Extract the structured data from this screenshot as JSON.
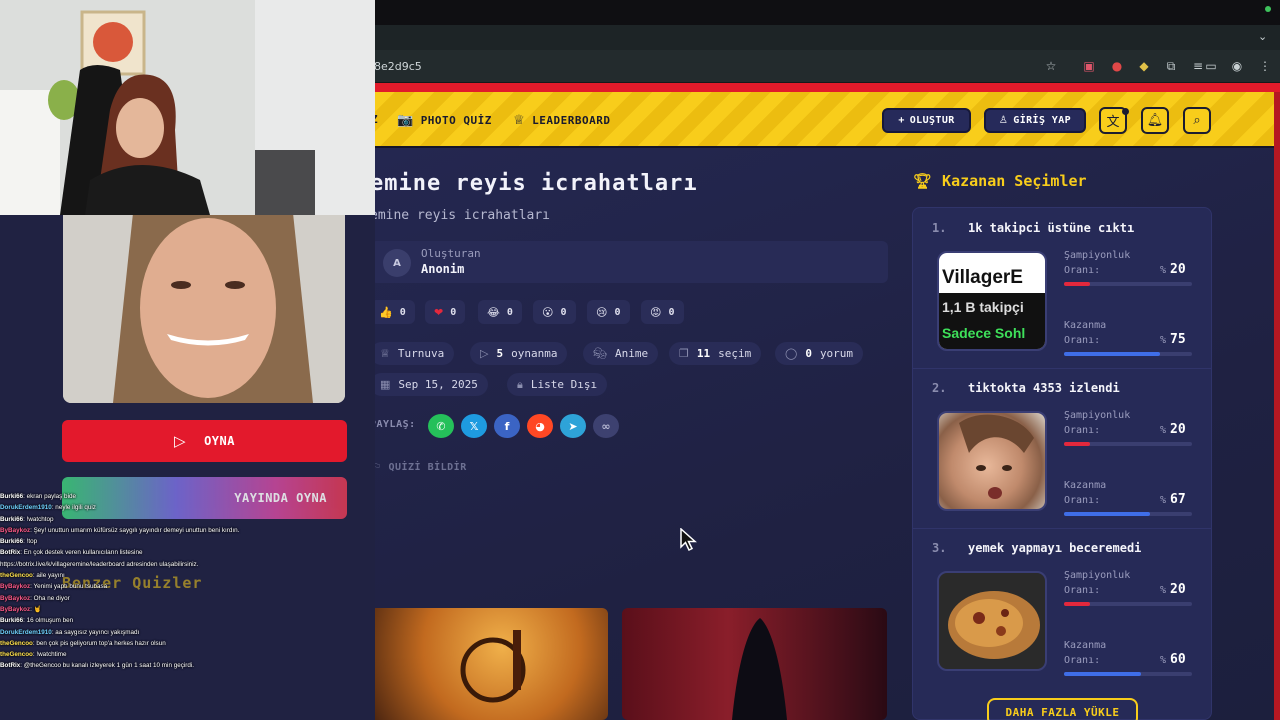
{
  "browser": {
    "url": "8e2d9c5"
  },
  "nav": {
    "photo_quiz": "PHOTO QUİZ",
    "leaderboard": "LEADERBOARD",
    "create": "OLUŞTUR",
    "login": "GİRİŞ YAP"
  },
  "quiz": {
    "title": "emine reyis icrahatları",
    "subtitle": "emine reyis icrahatları",
    "creator_label": "Oluşturan",
    "creator_name": "Anonim",
    "creator_initial": "A",
    "reactions": [
      {
        "emoji": "👍",
        "count": "0"
      },
      {
        "emoji": "❤",
        "count": "0"
      },
      {
        "emoji": "😂",
        "count": "0"
      },
      {
        "emoji": "😮",
        "count": "0"
      },
      {
        "emoji": "😢",
        "count": "0"
      },
      {
        "emoji": "😡",
        "count": "0"
      }
    ],
    "tags": {
      "type": "Turnuva",
      "plays_num": "5",
      "plays_label": "oynanma",
      "category": "Anime",
      "choices_num": "11",
      "choices_label": "seçim",
      "comments_num": "0",
      "comments_label": "yorum",
      "date": "Sep 15, 2025",
      "visibility": "Liste Dışı"
    },
    "share_label": "PAYLAŞ:",
    "report_label": "QUİZİ BİLDİR"
  },
  "left": {
    "play_label": "OYNA",
    "live_label": "YAYINDA OYNA",
    "similar_title": "Benzer Quizler"
  },
  "winners": {
    "title": "Kazanan Seçimler",
    "champ_label_1": "Şampiyonluk",
    "champ_label_2": "Oranı:",
    "win_label_1": "Kazanma",
    "win_label_2": "Oranı:",
    "pct": "%",
    "items": [
      {
        "rank": "1.",
        "name": "1k takipci üstüne cıktı",
        "champ": "20",
        "win": "75",
        "img_text_1": "VillagerE",
        "img_text_2": "1,1 B takipçi",
        "img_text_3": "Sadece Sohl"
      },
      {
        "rank": "2.",
        "name": "tiktokta 4353 izlendi",
        "champ": "20",
        "win": "67"
      },
      {
        "rank": "3.",
        "name": "yemek yapmayı beceremedi",
        "champ": "20",
        "win": "60"
      }
    ],
    "more_label": "DAHA FAZLA YÜKLE"
  },
  "chat": [
    {
      "user": "Burki66",
      "color": "#ffffff",
      "msg": ": ekran paylaş bide"
    },
    {
      "user": "DorukErdem1910",
      "color": "#6fd3ff",
      "msg": ": neyle ilgili quiz"
    },
    {
      "user": "Burki66",
      "color": "#ffffff",
      "msg": ": !watchtop"
    },
    {
      "user": "ByBaykoz",
      "color": "#ff5a8a",
      "msg": ": Şey! unuttun umarım küfürsüz saygılı yayındır demeyi unuttun beni kırdın."
    },
    {
      "user": "Burki66",
      "color": "#ffffff",
      "msg": ": !top"
    },
    {
      "user": "BotRix",
      "color": "#ffffff",
      "msg": ": En çok destek veren kullanıcıların listesine"
    },
    {
      "user": "",
      "color": "#ffffff",
      "msg": "https://botrix.live/k/villageremine/leaderboard adresinden ulaşabilirsiniz."
    },
    {
      "user": "theGencoo",
      "color": "#ffe14d",
      "msg": ": aile yayını"
    },
    {
      "user": "ByBaykoz",
      "color": "#ff5a8a",
      "msg": ": Yenimi yaptı bunu tsubasa"
    },
    {
      "user": "ByBaykoz",
      "color": "#ff5a8a",
      "msg": ": Oha ne diyor"
    },
    {
      "user": "ByBaykoz",
      "color": "#ff5a8a",
      "msg": ": 🤘"
    },
    {
      "user": "Burki66",
      "color": "#ffffff",
      "msg": ": 16 olmuşum ben"
    },
    {
      "user": "DorukErdem1910",
      "color": "#6fd3ff",
      "msg": ": aa saygısız yayıncı yakışmadı"
    },
    {
      "user": "theGencoo",
      "color": "#ffe14d",
      "msg": ": ben çok pis geliyorum top'a herkes hazır olsun"
    },
    {
      "user": "theGencoo",
      "color": "#ffe14d",
      "msg": ": !watchtime"
    },
    {
      "user": "BotRix",
      "color": "#ffffff",
      "msg": ": @theGencoo bu kanalı izleyerek 1 gün 1 saat 10 min geçirdi."
    }
  ]
}
